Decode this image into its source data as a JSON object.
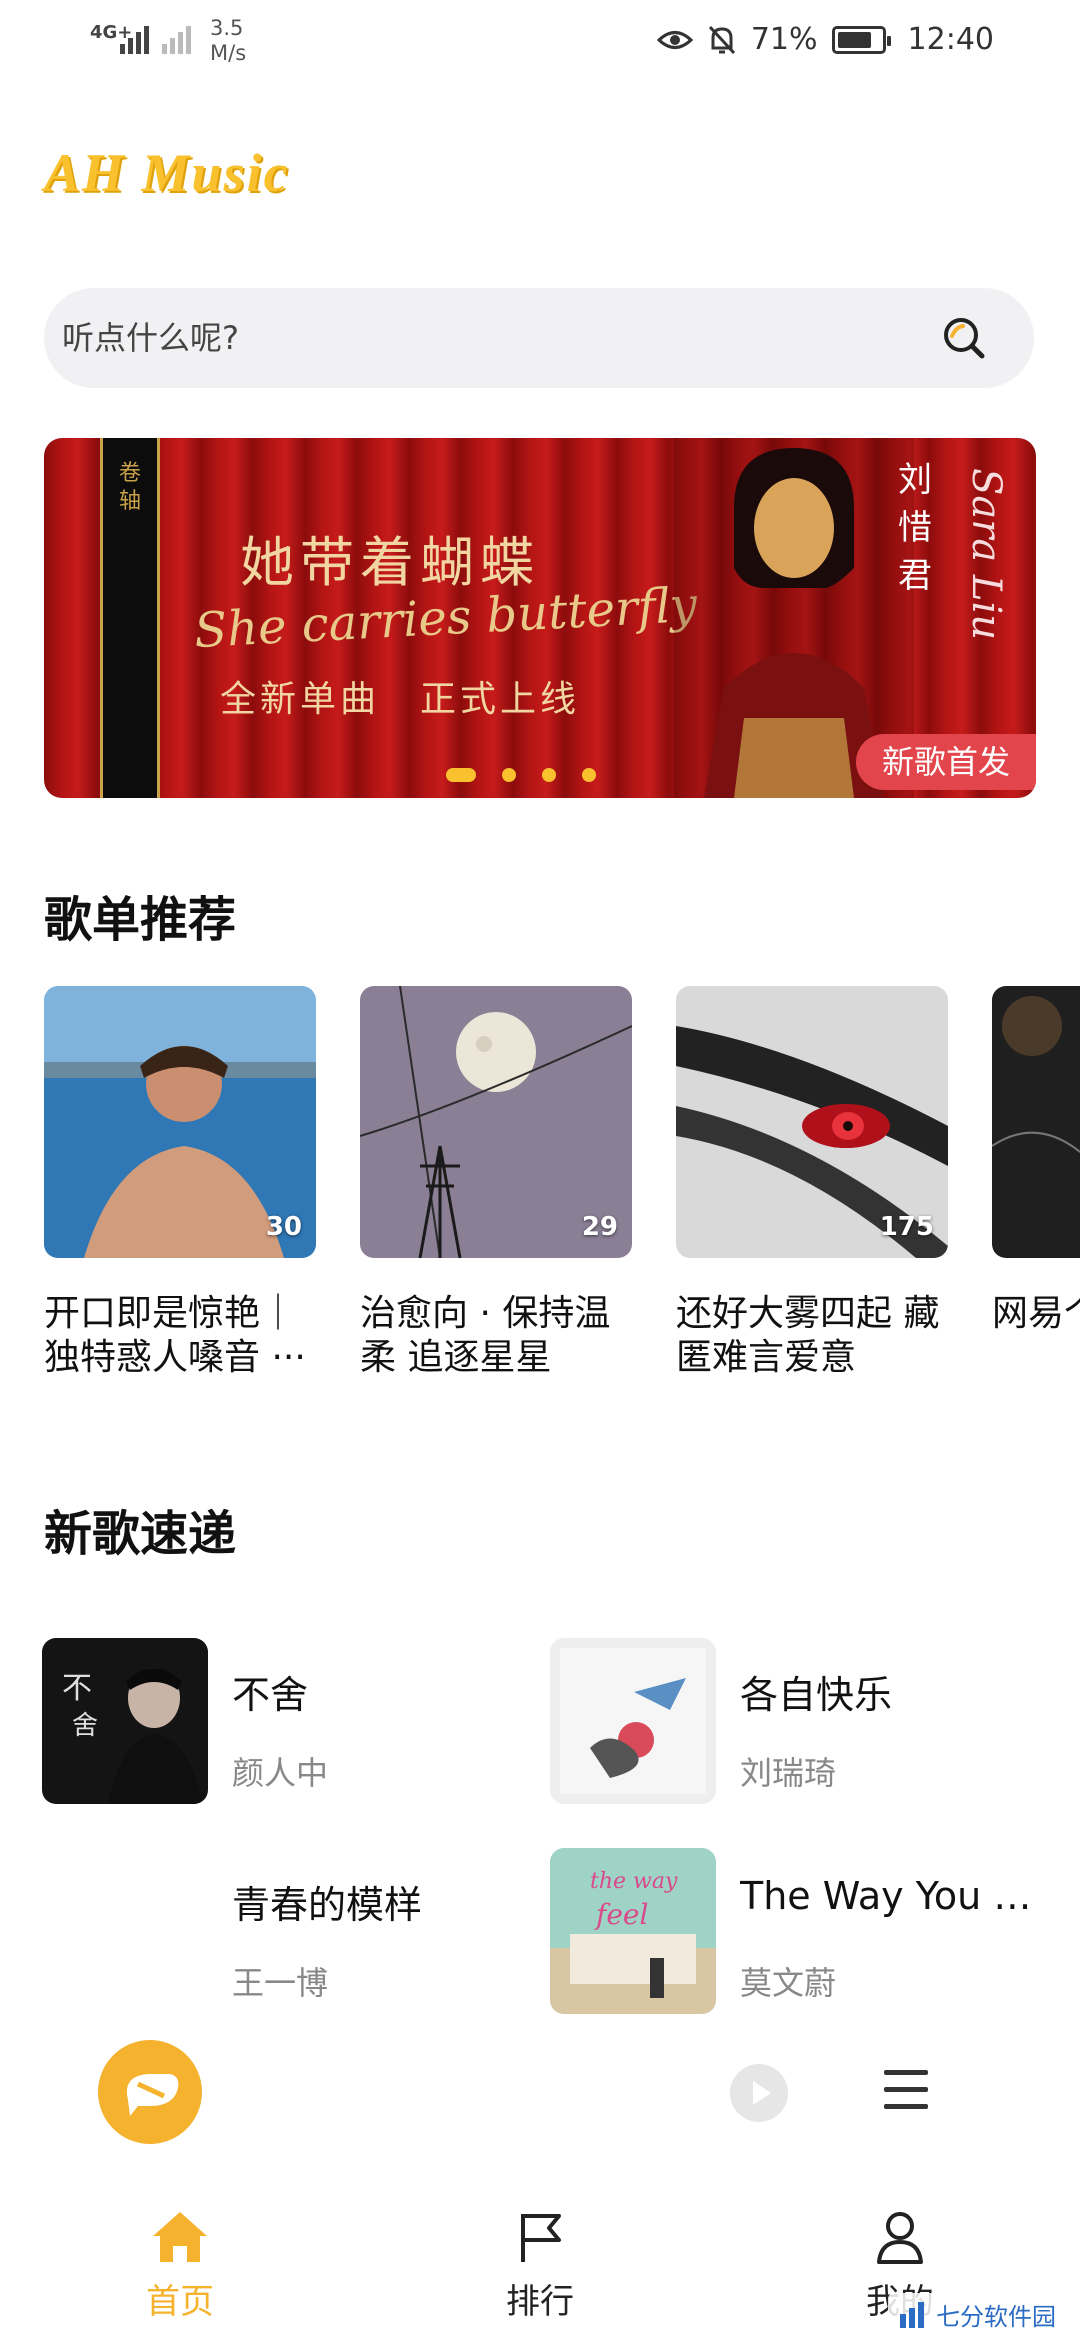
{
  "status_bar": {
    "network_left": "4G+",
    "speed": "3.5",
    "speed_unit": "M/s",
    "battery": "71%",
    "time": "12:40",
    "icons": [
      "eye-icon",
      "bell-off-icon",
      "battery-icon"
    ]
  },
  "app": {
    "logo": "AH Music"
  },
  "search": {
    "placeholder": "听点什么呢?"
  },
  "banner": {
    "title": "她带着蝴蝶",
    "script": "She carries butterfly",
    "subtitle_1": "全新单曲",
    "subtitle_2": "正式上线",
    "artist": "刘惜君",
    "artist_script": "Sara Liu",
    "badge": "新歌首发",
    "dots": 4,
    "active_dot": 0
  },
  "playlist_section": {
    "title": "歌单推荐",
    "items": [
      {
        "title": "开口即是惊艳｜独特惑人嗓音 ···",
        "count": "30"
      },
      {
        "title": "治愈向 · 保持温柔 追逐星星",
        "count": "29"
      },
      {
        "title": "还好大雾四起 藏匿难言爱意",
        "count": "175"
      },
      {
        "title": "网易个性",
        "count": ""
      }
    ]
  },
  "new_songs_section": {
    "title": "新歌速递",
    "items": [
      {
        "title": "不舍",
        "artist": "颜人中"
      },
      {
        "title": "各自快乐",
        "artist": "刘瑞琦"
      },
      {
        "title": "青春的模样",
        "artist": "王一博"
      },
      {
        "title": "The Way You M···",
        "artist": "莫文蔚"
      }
    ]
  },
  "player": {
    "icons": [
      "player-logo-icon",
      "play-icon",
      "playlist-menu-icon"
    ]
  },
  "tabs": [
    {
      "label": "首页",
      "icon": "home-icon",
      "active": true
    },
    {
      "label": "排行",
      "icon": "flag-icon",
      "active": false
    },
    {
      "label": "我的",
      "icon": "user-icon",
      "active": false
    }
  ],
  "watermark": {
    "text": "七分软件园"
  },
  "colors": {
    "accent": "#F5B22E",
    "logo": "#F9C12E",
    "badge": "#E2454B",
    "banner_red": "#B31414"
  }
}
